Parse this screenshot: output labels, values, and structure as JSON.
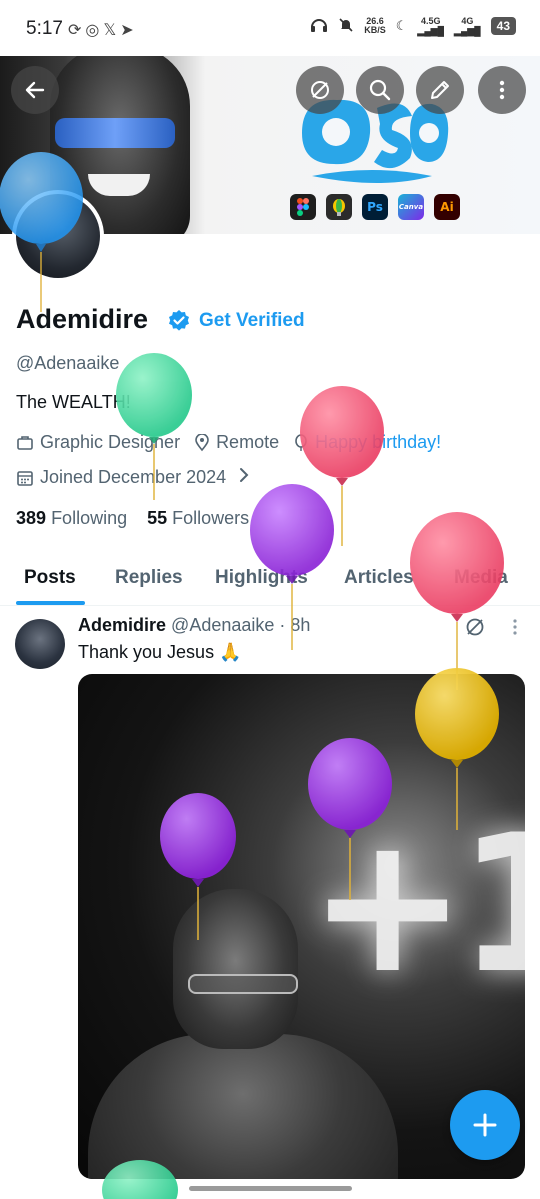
{
  "status_bar": {
    "time": "5:17",
    "left_icons": [
      "sync-icon",
      "whatsapp-icon",
      "x-icon",
      "telegram-icon"
    ],
    "net_speed_value": "26.6",
    "net_speed_unit": "KB/S",
    "net_a": "4.5G",
    "net_b": "4G",
    "battery": "43"
  },
  "header": {
    "buttons": [
      "back-icon",
      "grok-icon",
      "search-icon",
      "edit-icon",
      "more-vertical-icon"
    ],
    "banner_logo": "oso",
    "banner_apps": [
      {
        "label": "",
        "color": "#1e1e1e"
      },
      {
        "label": "",
        "color": "#2b2b2b"
      },
      {
        "label": "Ps",
        "color": "#001e36"
      },
      {
        "label": "Canva",
        "color": "#19b3d6"
      },
      {
        "label": "Ai",
        "color": "#330000"
      }
    ]
  },
  "profile": {
    "name": "Ademidire",
    "get_verified": "Get Verified",
    "handle": "@Adenaaike",
    "bio": "The WEALTH!",
    "category": "Graphic Designer",
    "location": "Remote",
    "birthday": "Happy birthday!",
    "joined": "Joined December 2024",
    "following_count": "389",
    "following_label": "Following",
    "followers_count": "55",
    "followers_label": "Followers"
  },
  "tabs": [
    {
      "label": "Posts",
      "active": true
    },
    {
      "label": "Replies",
      "active": false
    },
    {
      "label": "Highlights",
      "active": false
    },
    {
      "label": "Articles",
      "active": false
    },
    {
      "label": "Media",
      "active": false
    }
  ],
  "post": {
    "author": "Ademidire",
    "handle": "@Adenaaike",
    "time": "· 8h",
    "text": "Thank you Jesus 🙏",
    "image_text": "+1"
  },
  "colors": {
    "accent": "#1d9bf0",
    "text_primary": "#0f1419",
    "text_secondary": "#536471"
  }
}
